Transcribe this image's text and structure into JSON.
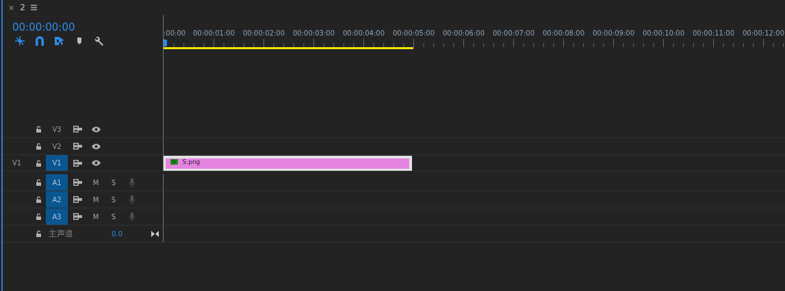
{
  "panel_tab": {
    "close": "×",
    "title": "2"
  },
  "timecode": "00:00:00:00",
  "toolbar": [
    {
      "kind": "nest",
      "on": true
    },
    {
      "kind": "snap",
      "on": true
    },
    {
      "kind": "linked",
      "on": true
    },
    {
      "kind": "marker",
      "on": false
    },
    {
      "kind": "settings",
      "on": false
    }
  ],
  "ruler": {
    "labels": [
      ":00:00",
      "00:00:01:00",
      "00:00:02:00",
      "00:00:03:00",
      "00:00:04:00",
      "00:00:05:00",
      "00:00:06:00",
      "00:00:07:00",
      "00:00:08:00",
      "00:00:09:00",
      "00:00:10:00",
      "00:00:11:00",
      "00:00:12:00"
    ],
    "work_area": {
      "level": 0.4
    }
  },
  "tracks": [
    {
      "kind": "video",
      "label": "V3",
      "targeted": false
    },
    {
      "kind": "video",
      "label": "V2",
      "targeted": false
    },
    {
      "kind": "video",
      "label": "V1",
      "targeted": true,
      "source": "V1",
      "clip": {
        "name": "S.png",
        "fx": "fx"
      }
    },
    {
      "kind": "audio",
      "label": "A1",
      "targeted": true,
      "mute": "M",
      "solo": "S"
    },
    {
      "kind": "audio",
      "label": "A2",
      "targeted": true,
      "mute": "M",
      "solo": "S"
    },
    {
      "kind": "audio",
      "label": "A3",
      "targeted": true,
      "mute": "M",
      "solo": "S"
    },
    {
      "kind": "master",
      "label": "主声道",
      "value": "0.0"
    }
  ]
}
